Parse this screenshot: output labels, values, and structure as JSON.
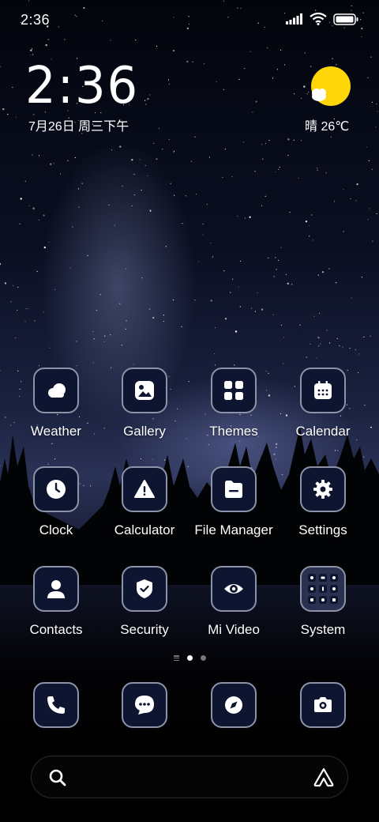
{
  "status_bar": {
    "time": "2:36",
    "icons": [
      "signal-icon",
      "wifi-icon",
      "battery-icon"
    ]
  },
  "clock_widget": {
    "time": "2:36",
    "date": "7月26日 周三下午"
  },
  "weather_widget": {
    "icon": "sunny-cloud-icon",
    "text": "晴 26℃",
    "sun_color": "#FFD60A"
  },
  "apps": [
    {
      "label": "Weather",
      "icon": "weather-icon"
    },
    {
      "label": "Gallery",
      "icon": "gallery-icon"
    },
    {
      "label": "Themes",
      "icon": "themes-icon"
    },
    {
      "label": "Calendar",
      "icon": "calendar-icon"
    },
    {
      "label": "Clock",
      "icon": "clock-icon"
    },
    {
      "label": "Calculator",
      "icon": "calculator-icon"
    },
    {
      "label": "File Manager",
      "icon": "file-manager-icon"
    },
    {
      "label": "Settings",
      "icon": "settings-icon"
    },
    {
      "label": "Contacts",
      "icon": "contacts-icon"
    },
    {
      "label": "Security",
      "icon": "security-icon"
    },
    {
      "label": "Mi Video",
      "icon": "mi-video-icon"
    },
    {
      "label": "System",
      "icon": "system-folder-icon"
    }
  ],
  "page_indicator": {
    "pages": 2,
    "current": 1
  },
  "dock": [
    {
      "icon": "phone-icon"
    },
    {
      "icon": "messages-icon"
    },
    {
      "icon": "browser-icon"
    },
    {
      "icon": "camera-icon"
    }
  ],
  "search_bar": {
    "left_icon": "search-icon",
    "right_icon": "assistant-icon"
  },
  "theme": {
    "icon_background": "#0E1530",
    "icon_border": "#8C93A8"
  }
}
